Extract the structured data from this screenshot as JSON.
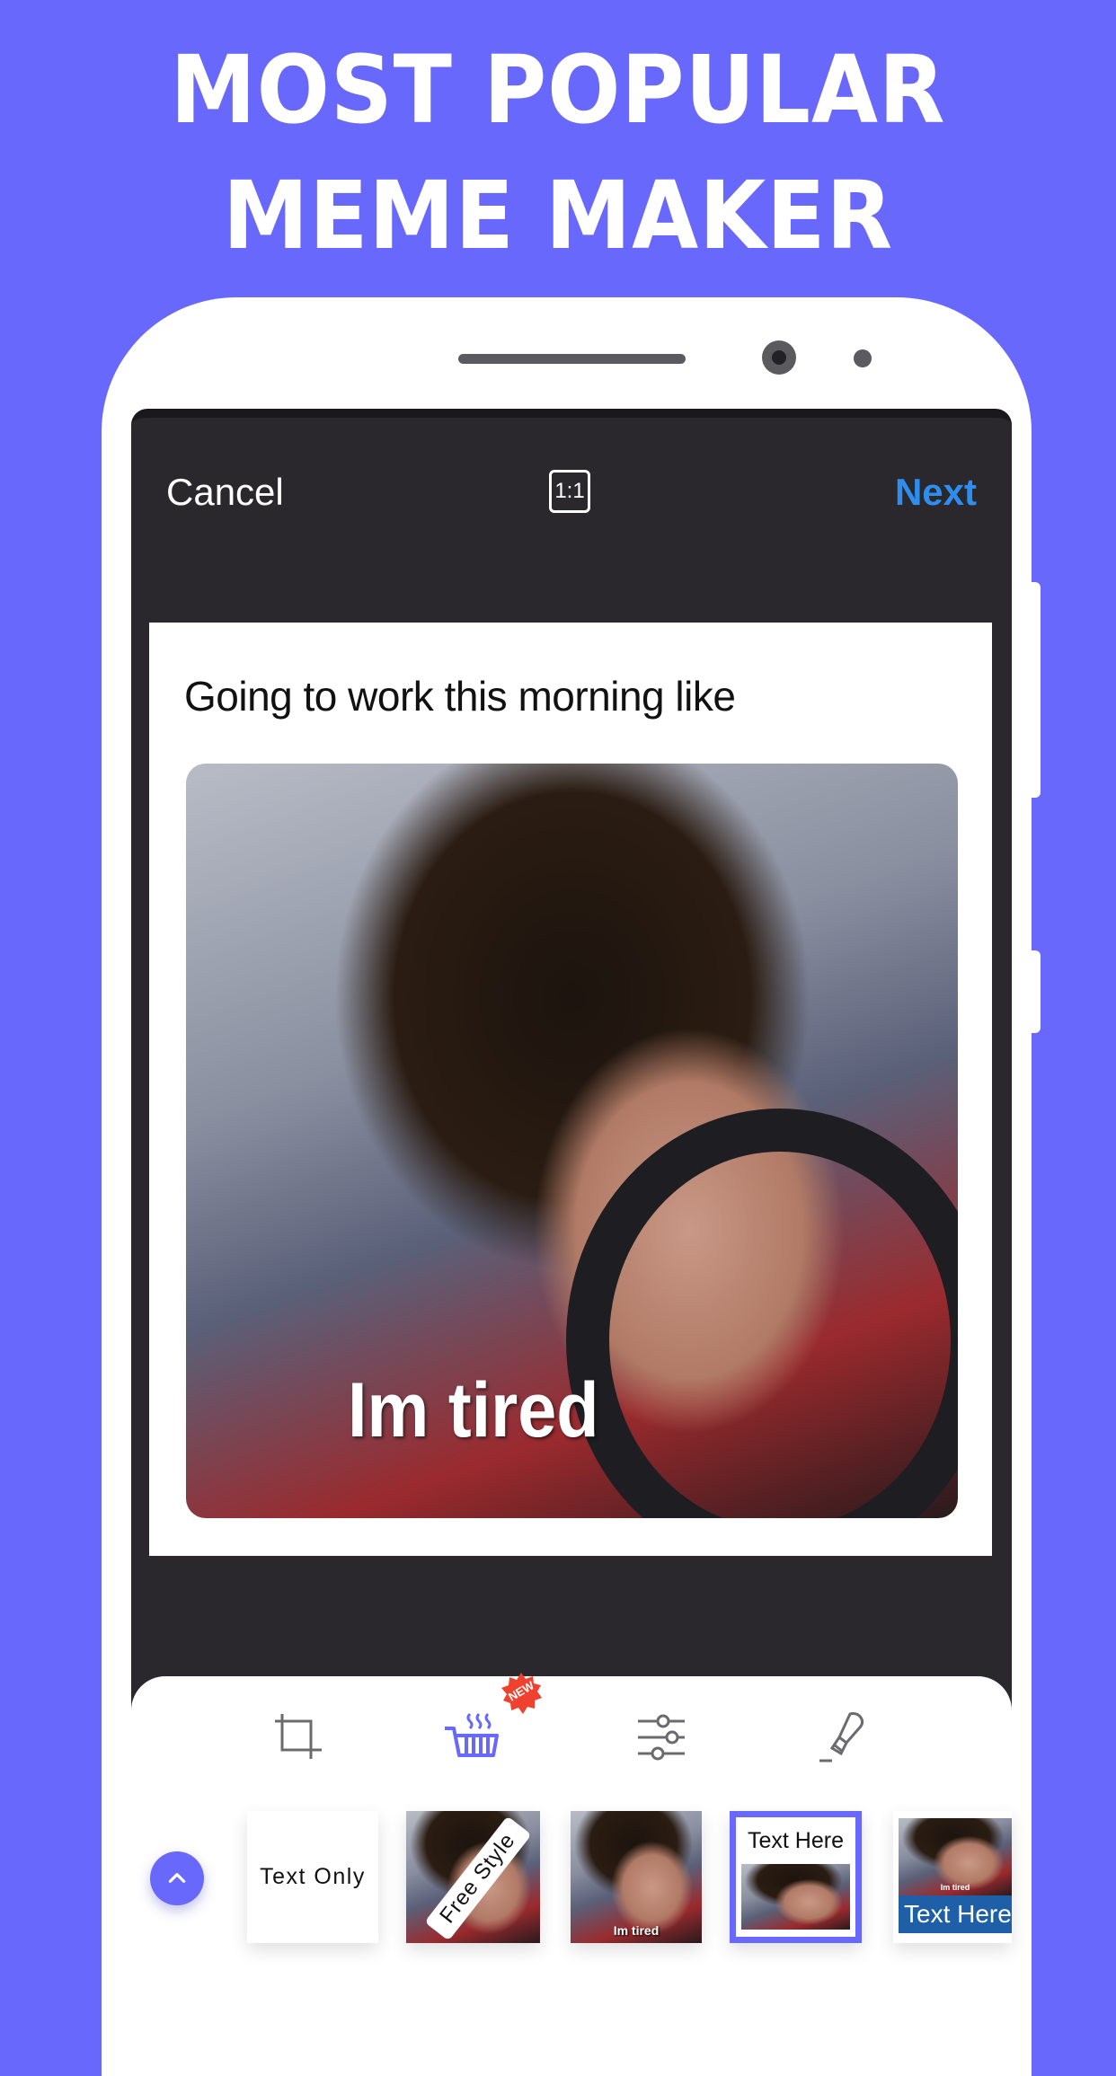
{
  "promo": {
    "headline_line1": "MOST POPULAR",
    "headline_line2": "MEME MAKER",
    "background_color": "#6868fc"
  },
  "header": {
    "cancel_label": "Cancel",
    "aspect_ratio_label": "1:1",
    "next_label": "Next",
    "next_color": "#2e8ef0"
  },
  "meme": {
    "caption": "Going to work this morning like",
    "image_text": "Im tired"
  },
  "toolbar": {
    "tools": [
      {
        "name": "crop-icon",
        "active": false
      },
      {
        "name": "template-basket-icon",
        "active": true,
        "badge": "NEW"
      },
      {
        "name": "adjust-sliders-icon",
        "active": false
      },
      {
        "name": "brush-icon",
        "active": false
      }
    ],
    "accent_color": "#6868fc",
    "badge_color": "#f0402e"
  },
  "templates": {
    "items": [
      {
        "label": "Text Only",
        "selected": false
      },
      {
        "label": "Free Style",
        "selected": false
      },
      {
        "label": "Im tired",
        "selected": false
      },
      {
        "label": "Text Here",
        "selected": true
      },
      {
        "label": "Text Here",
        "caption": "Im tired",
        "selected": false
      }
    ]
  }
}
